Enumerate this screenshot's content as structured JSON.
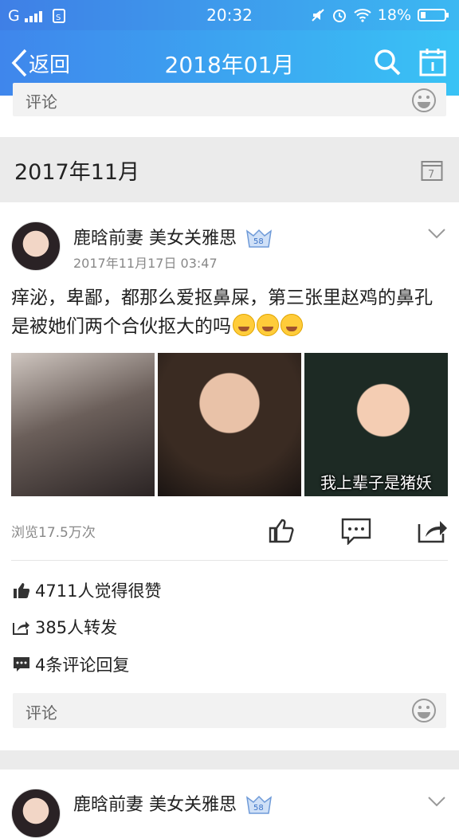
{
  "status_bar": {
    "carrier": "G",
    "time": "20:32",
    "battery": "18%"
  },
  "nav": {
    "back_label": "返回",
    "title": "2018年01月"
  },
  "prev_post": {
    "comment_placeholder": "评论"
  },
  "month_header": {
    "label": "2017年11月",
    "calendar_day": "7"
  },
  "post": {
    "user": "鹿晗前妻 美女关雅思",
    "badge": "58",
    "time": "2017年11月17日 03:47",
    "text": "痒泌，卑鄙，都那么爱抠鼻屎，第三张里赵鸡的鼻孔是被她们两个合伙抠大的吗",
    "photo_caption": "我上辈子是猪妖",
    "views": "浏览17.5万次",
    "likes": "4711人觉得很赞",
    "shares": "385人转发",
    "comments": "4条评论回复",
    "comment_placeholder": "评论"
  },
  "next_post": {
    "user": "鹿晗前妻 美女关雅思",
    "badge": "58"
  },
  "colors": {
    "header_start": "#3f86ec",
    "header_end": "#39c3f5"
  }
}
